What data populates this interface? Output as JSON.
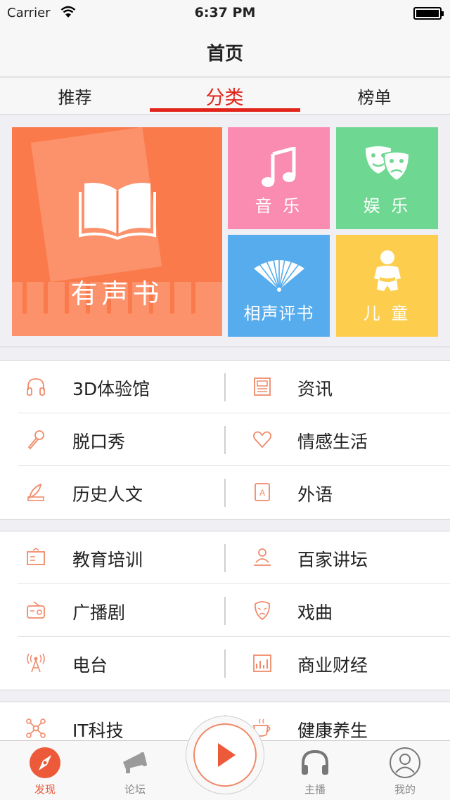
{
  "status_bar": {
    "carrier": "Carrier",
    "time": "6:37 PM"
  },
  "nav": {
    "title": "首页"
  },
  "segments": [
    {
      "label": "推荐",
      "active": false
    },
    {
      "label": "分类",
      "active": true
    },
    {
      "label": "榜单",
      "active": false
    }
  ],
  "accent_color": "#e2231a",
  "featured": {
    "audiobook": {
      "label": "有声书",
      "icon": "open-book-icon",
      "color": "#fb7a4b"
    },
    "music": {
      "label": "音 乐",
      "icon": "music-note-icon",
      "color": "#fa8bb1"
    },
    "entertainment": {
      "label": "娱 乐",
      "icon": "theater-masks-icon",
      "color": "#6ed892"
    },
    "crosstalk": {
      "label": "相声评书",
      "icon": "folding-fan-icon",
      "color": "#56acec"
    },
    "kids": {
      "label": "儿 童",
      "icon": "baby-icon",
      "color": "#fdcd4d"
    }
  },
  "sections": [
    {
      "rows": [
        {
          "left": {
            "label": "3D体验馆",
            "icon": "headphones-icon"
          },
          "right": {
            "label": "资讯",
            "icon": "newspaper-icon"
          }
        },
        {
          "left": {
            "label": "脱口秀",
            "icon": "microphone-icon"
          },
          "right": {
            "label": "情感生活",
            "icon": "heart-icon"
          }
        },
        {
          "left": {
            "label": "历史人文",
            "icon": "quill-icon"
          },
          "right": {
            "label": "外语",
            "icon": "dictionary-icon"
          }
        }
      ]
    },
    {
      "rows": [
        {
          "left": {
            "label": "教育培训",
            "icon": "blackboard-icon"
          },
          "right": {
            "label": "百家讲坛",
            "icon": "lecturer-icon"
          }
        },
        {
          "left": {
            "label": "广播剧",
            "icon": "radio-icon"
          },
          "right": {
            "label": "戏曲",
            "icon": "opera-mask-icon"
          }
        },
        {
          "left": {
            "label": "电台",
            "icon": "antenna-icon"
          },
          "right": {
            "label": "商业财经",
            "icon": "bar-chart-icon"
          }
        }
      ]
    },
    {
      "rows": [
        {
          "left": {
            "label": "IT科技",
            "icon": "network-icon"
          },
          "right": {
            "label": "健康养生",
            "icon": "tea-cup-icon"
          }
        }
      ]
    }
  ],
  "tabbar": {
    "discover": {
      "label": "发现",
      "icon": "compass-icon"
    },
    "forum": {
      "label": "论坛",
      "icon": "megaphone-icon"
    },
    "play": {
      "icon": "play-icon"
    },
    "anchor": {
      "label": "主播",
      "icon": "headphones-icon"
    },
    "mine": {
      "label": "我的",
      "icon": "user-avatar-icon"
    }
  }
}
